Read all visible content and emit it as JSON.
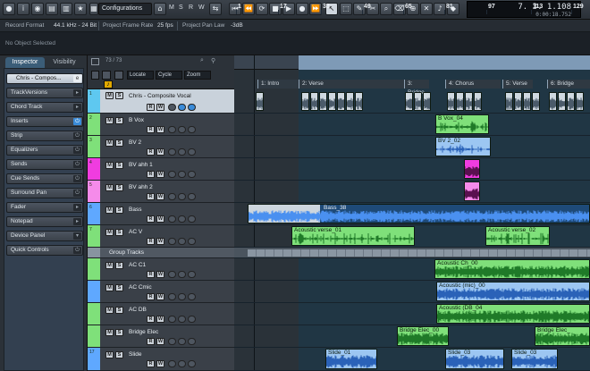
{
  "toolbar": {
    "mode_select": "Configurations",
    "letters": [
      "M",
      "S",
      "R",
      "W"
    ],
    "timecode_main": "7. 3. 1.108",
    "timecode_sub": "0:00:18.752"
  },
  "info_line": {
    "record_format_label": "Record Format",
    "record_format_value": "44.1 kHz - 24 Bit",
    "frame_rate_label": "Project Frame Rate",
    "frame_rate_value": "25 fps",
    "pan_law_label": "Project Pan Law",
    "pan_law_value": "-3dB"
  },
  "status": {
    "text": "No Object Selected"
  },
  "inspector": {
    "tabs": [
      "Inspector",
      "Visibility"
    ],
    "track_name": "Chris - Compos...",
    "sections": [
      "TrackVersions",
      "Chord Track",
      "Inserts",
      "Strip",
      "Equalizers",
      "Sends",
      "Cue Sends",
      "Surround Pan",
      "Fader",
      "Notepad",
      "Device Panel",
      "Quick Controls"
    ]
  },
  "tracklist_header": {
    "count": "73 / 73",
    "locate": "Locate",
    "cycle": "Cycle",
    "zoom": "Zoom"
  },
  "tracks": [
    {
      "num": "1",
      "name": "Chris - Composite Vocal",
      "color": "#5ec8f0"
    },
    {
      "num": "2",
      "name": "B Vox",
      "color": "#7fe07a"
    },
    {
      "num": "3",
      "name": "BV 2",
      "color": "#7fe07a"
    },
    {
      "num": "4",
      "name": "BV ahh 1",
      "color": "#f03ce0"
    },
    {
      "num": "5",
      "name": "BV ahh 2",
      "color": "#f58bea"
    },
    {
      "num": "6",
      "name": "Bass",
      "color": "#5fa8ff"
    },
    {
      "num": "7",
      "name": "AC V",
      "color": "#7fe07a"
    },
    {
      "num": "",
      "name": "Group Tracks",
      "color": "#8894a0"
    },
    {
      "num": "",
      "name": "AC C1",
      "color": "#7fe07a"
    },
    {
      "num": "",
      "name": "AC Cmic",
      "color": "#5fa8ff"
    },
    {
      "num": "",
      "name": "AC DB",
      "color": "#7fe07a"
    },
    {
      "num": "",
      "name": "Bridge Elec",
      "color": "#7fe07a"
    },
    {
      "num": "17",
      "name": "Slide",
      "color": "#5fa8ff"
    }
  ],
  "ruler": {
    "marks": [
      "1",
      "17",
      "33",
      "49",
      "65",
      "81",
      "97",
      "113",
      "129"
    ]
  },
  "markers": [
    {
      "label": "1: Intro"
    },
    {
      "label": "2: Verse"
    },
    {
      "label": "3: Bridge"
    },
    {
      "label": "4: Chorus"
    },
    {
      "label": "5: Verse"
    },
    {
      "label": "6: Bridge"
    }
  ],
  "parts": [
    {
      "label": "B Vox_04",
      "color": "#7fe07a"
    },
    {
      "label": "BV 2_02",
      "color": "#9cc6f2"
    },
    {
      "label": "Bass_38",
      "color": "#c8d6e2"
    },
    {
      "label": "Acoustic verse_01",
      "color": "#7fe07a"
    },
    {
      "label": "Acoustic verse_02",
      "color": "#7fe07a"
    },
    {
      "label": "Acoustic Ch_00",
      "color": "#7fe07a"
    },
    {
      "label": "Acoustic (mic)_00",
      "color": "#9cc6f2"
    },
    {
      "label": "Acoustic (DB_04",
      "color": "#7fe07a"
    },
    {
      "label": "Bridge Elec_00",
      "color": "#7fe07a"
    },
    {
      "label": "Bridge Elec_",
      "color": "#7fe07a"
    },
    {
      "label": "Slide_01",
      "color": "#9cc6f2"
    },
    {
      "label": "Slide_03",
      "color": "#9cc6f2"
    },
    {
      "label": "Slide_03",
      "color": "#9cc6f2"
    }
  ]
}
